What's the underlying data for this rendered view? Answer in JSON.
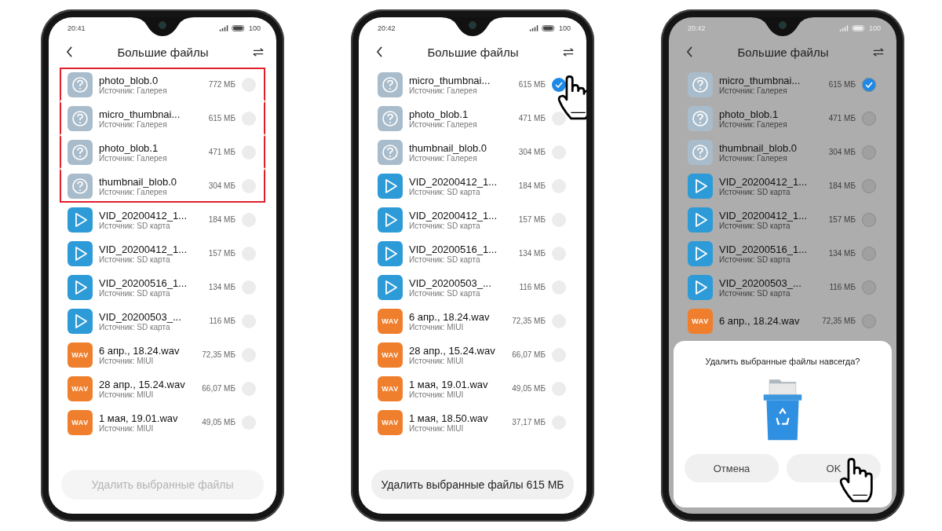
{
  "phones": [
    {
      "status_bar": {
        "time": "20:41",
        "battery": "100"
      },
      "title": "Большие файлы",
      "items": [
        {
          "kind": "unknown",
          "name": "photo_blob.0",
          "source": "Источник: Галерея",
          "size": "772 МБ",
          "checked": false,
          "highlighted": true,
          "pointed": false
        },
        {
          "kind": "unknown",
          "name": "micro_thumbnai...",
          "source": "Источник: Галерея",
          "size": "615 МБ",
          "checked": false,
          "highlighted": true,
          "pointed": false
        },
        {
          "kind": "unknown",
          "name": "photo_blob.1",
          "source": "Источник: Галерея",
          "size": "471 МБ",
          "checked": false,
          "highlighted": true,
          "pointed": false
        },
        {
          "kind": "unknown",
          "name": "thumbnail_blob.0",
          "source": "Источник: Галерея",
          "size": "304 МБ",
          "checked": false,
          "highlighted": true,
          "pointed": false
        },
        {
          "kind": "video",
          "name": "VID_20200412_1...",
          "source": "Источник: SD карта",
          "size": "184 МБ",
          "checked": false,
          "highlighted": false,
          "pointed": false
        },
        {
          "kind": "video",
          "name": "VID_20200412_1...",
          "source": "Источник: SD карта",
          "size": "157 МБ",
          "checked": false,
          "highlighted": false,
          "pointed": false
        },
        {
          "kind": "video",
          "name": "VID_20200516_1...",
          "source": "Источник: SD карта",
          "size": "134 МБ",
          "checked": false,
          "highlighted": false,
          "pointed": false
        },
        {
          "kind": "video",
          "name": "VID_20200503_...",
          "source": "Источник: SD карта",
          "size": "116 МБ",
          "checked": false,
          "highlighted": false,
          "pointed": false
        },
        {
          "kind": "wav",
          "badge": "WAV",
          "name": "6 апр., 18.24.wav",
          "source": "Источник: MIUI",
          "size": "72,35 МБ",
          "checked": false,
          "highlighted": false,
          "pointed": false
        },
        {
          "kind": "wav",
          "badge": "WAV",
          "name": "28 апр., 15.24.wav",
          "source": "Источник: MIUI",
          "size": "66,07 МБ",
          "checked": false,
          "highlighted": false,
          "pointed": false
        },
        {
          "kind": "wav",
          "badge": "WAV",
          "name": "1 мая, 19.01.wav",
          "source": "Источник: MIUI",
          "size": "49,05 МБ",
          "checked": false,
          "highlighted": false,
          "pointed": false
        }
      ],
      "delete_button": {
        "label": "Удалить выбранные файлы",
        "disabled": true
      }
    },
    {
      "status_bar": {
        "time": "20:42",
        "battery": "100"
      },
      "title": "Большие файлы",
      "items": [
        {
          "kind": "unknown",
          "name": "micro_thumbnai...",
          "source": "Источник: Галерея",
          "size": "615 МБ",
          "checked": true,
          "highlighted": false,
          "pointed": true
        },
        {
          "kind": "unknown",
          "name": "photo_blob.1",
          "source": "Источник: Галерея",
          "size": "471 МБ",
          "checked": false,
          "highlighted": false,
          "pointed": false
        },
        {
          "kind": "unknown",
          "name": "thumbnail_blob.0",
          "source": "Источник: Галерея",
          "size": "304 МБ",
          "checked": false,
          "highlighted": false,
          "pointed": false
        },
        {
          "kind": "video",
          "name": "VID_20200412_1...",
          "source": "Источник: SD карта",
          "size": "184 МБ",
          "checked": false,
          "highlighted": false,
          "pointed": false
        },
        {
          "kind": "video",
          "name": "VID_20200412_1...",
          "source": "Источник: SD карта",
          "size": "157 МБ",
          "checked": false,
          "highlighted": false,
          "pointed": false
        },
        {
          "kind": "video",
          "name": "VID_20200516_1...",
          "source": "Источник: SD карта",
          "size": "134 МБ",
          "checked": false,
          "highlighted": false,
          "pointed": false
        },
        {
          "kind": "video",
          "name": "VID_20200503_...",
          "source": "Источник: SD карта",
          "size": "116 МБ",
          "checked": false,
          "highlighted": false,
          "pointed": false
        },
        {
          "kind": "wav",
          "badge": "WAV",
          "name": "6 апр., 18.24.wav",
          "source": "Источник: MIUI",
          "size": "72,35 МБ",
          "checked": false,
          "highlighted": false,
          "pointed": false
        },
        {
          "kind": "wav",
          "badge": "WAV",
          "name": "28 апр., 15.24.wav",
          "source": "Источник: MIUI",
          "size": "66,07 МБ",
          "checked": false,
          "highlighted": false,
          "pointed": false
        },
        {
          "kind": "wav",
          "badge": "WAV",
          "name": "1 мая, 19.01.wav",
          "source": "Источник: MIUI",
          "size": "49,05 МБ",
          "checked": false,
          "highlighted": false,
          "pointed": false
        },
        {
          "kind": "wav",
          "badge": "WAV",
          "name": "1 мая, 18.50.wav",
          "source": "Источник: MIUI",
          "size": "37,17 МБ",
          "checked": false,
          "highlighted": false,
          "pointed": false
        }
      ],
      "delete_button": {
        "label": "Удалить выбранные файлы 615 МБ",
        "disabled": false
      }
    },
    {
      "status_bar": {
        "time": "20:42",
        "battery": "100"
      },
      "title": "Большие файлы",
      "items": [
        {
          "kind": "unknown",
          "name": "micro_thumbnai...",
          "source": "Источник: Галерея",
          "size": "615 МБ",
          "checked": true,
          "highlighted": false,
          "pointed": false
        },
        {
          "kind": "unknown",
          "name": "photo_blob.1",
          "source": "Источник: Галерея",
          "size": "471 МБ",
          "checked": false,
          "highlighted": false,
          "pointed": false
        },
        {
          "kind": "unknown",
          "name": "thumbnail_blob.0",
          "source": "Источник: Галерея",
          "size": "304 МБ",
          "checked": false,
          "highlighted": false,
          "pointed": false
        },
        {
          "kind": "video",
          "name": "VID_20200412_1...",
          "source": "Источник: SD карта",
          "size": "184 МБ",
          "checked": false,
          "highlighted": false,
          "pointed": false
        },
        {
          "kind": "video",
          "name": "VID_20200412_1...",
          "source": "Источник: SD карта",
          "size": "157 МБ",
          "checked": false,
          "highlighted": false,
          "pointed": false
        },
        {
          "kind": "video",
          "name": "VID_20200516_1...",
          "source": "Источник: SD карта",
          "size": "134 МБ",
          "checked": false,
          "highlighted": false,
          "pointed": false
        },
        {
          "kind": "video",
          "name": "VID_20200503_...",
          "source": "Источник: SD карта",
          "size": "116 МБ",
          "checked": false,
          "highlighted": false,
          "pointed": false
        },
        {
          "kind": "wav",
          "badge": "WAV",
          "name": "6 апр., 18.24.wav",
          "size": "72,35 МБ",
          "checked": false,
          "highlighted": false,
          "pointed": false
        }
      ],
      "dialog": {
        "message": "Удалить выбранные файлы навсегда?",
        "buttons": [
          {
            "label": "Отмена",
            "pointed": false
          },
          {
            "label": "OK",
            "pointed": true
          }
        ]
      }
    }
  ]
}
